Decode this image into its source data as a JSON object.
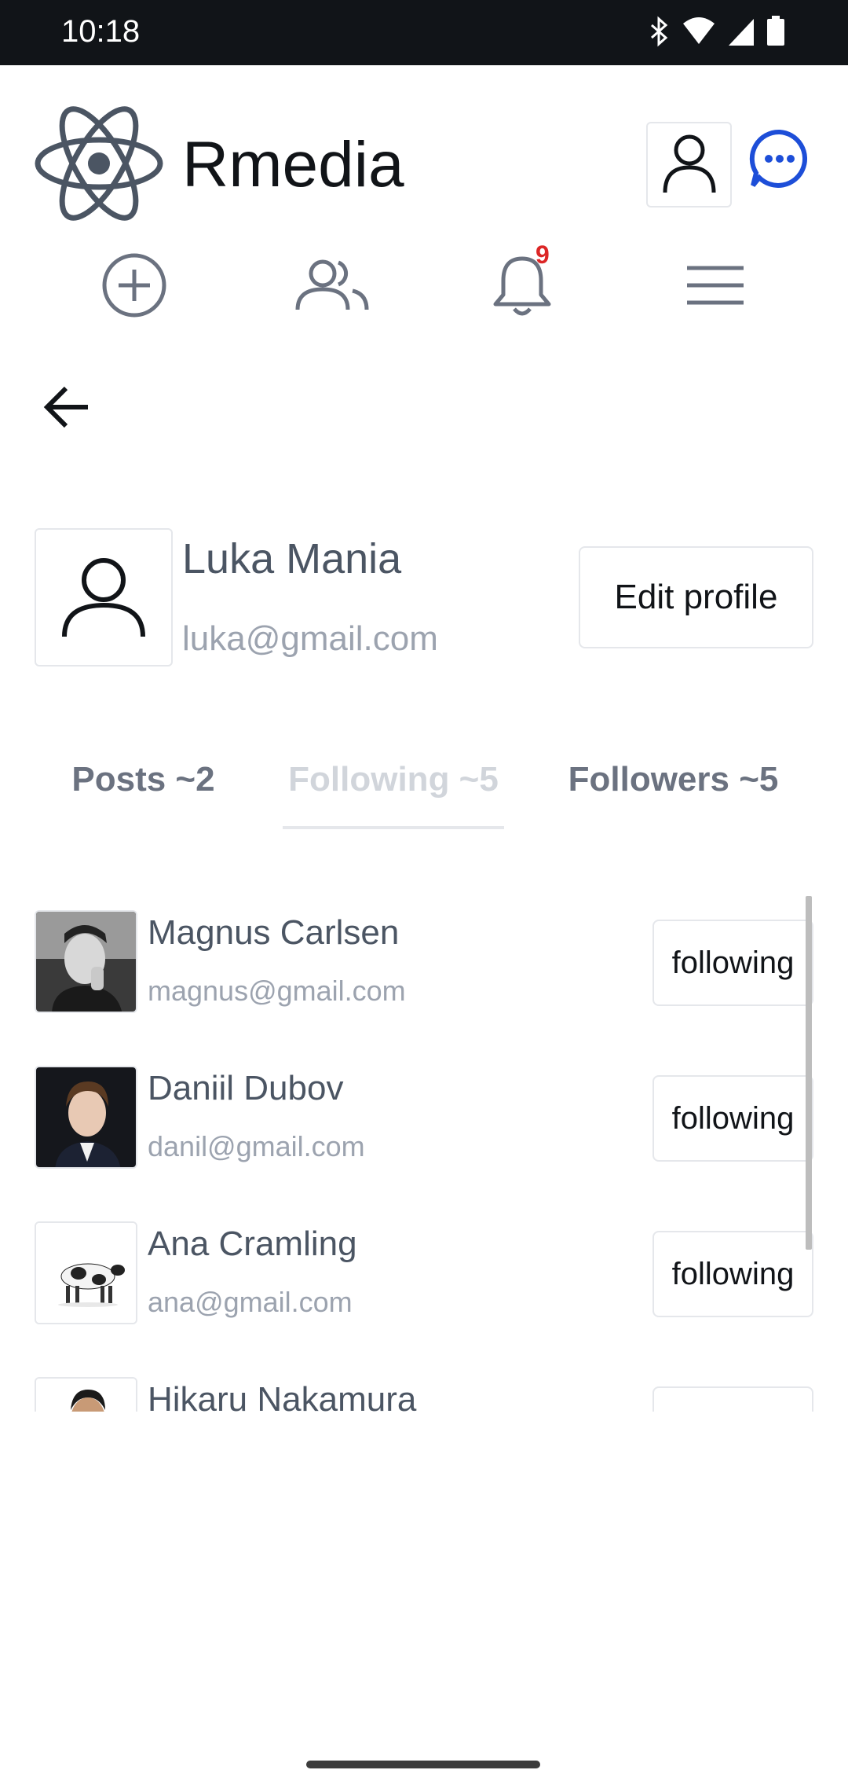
{
  "status_bar": {
    "time": "10:18",
    "icons": [
      "bluetooth-icon",
      "wifi-icon",
      "cellular-icon",
      "battery-icon"
    ]
  },
  "header": {
    "app_title": "Rmedia",
    "brand_color": "#4b5563",
    "chat_color": "#1d4ed8"
  },
  "nav": {
    "notification_count": "9"
  },
  "profile": {
    "name": "Luka Mania",
    "email": "luka@gmail.com",
    "edit_label": "Edit profile"
  },
  "tabs": [
    {
      "label": "Posts ~2",
      "active": false
    },
    {
      "label": "Following ~5",
      "active": true
    },
    {
      "label": "Followers ~5",
      "active": false
    }
  ],
  "following_list": [
    {
      "name": "Magnus Carlsen",
      "email": "magnus@gmail.com",
      "button": "following"
    },
    {
      "name": "Daniil Dubov",
      "email": "danil@gmail.com",
      "button": "following"
    },
    {
      "name": "Ana Cramling",
      "email": "ana@gmail.com",
      "button": "following"
    },
    {
      "name": "Hikaru Nakamura",
      "email": "",
      "button": ""
    }
  ]
}
